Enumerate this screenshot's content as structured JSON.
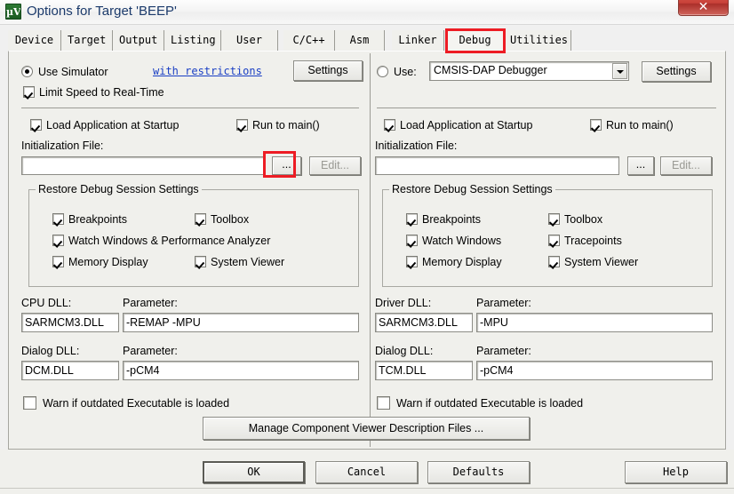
{
  "window": {
    "title": "Options for Target 'BEEP'",
    "icon": "keil-uvision-icon",
    "icon_text": "µVs",
    "close_label": "✕",
    "accent_red": "#ed1c24",
    "link_blue": "#1a3fc4",
    "title_blue": "#1b3a6b"
  },
  "tabs": [
    {
      "label": "Device",
      "selected": false
    },
    {
      "label": "Target",
      "selected": false
    },
    {
      "label": "Output",
      "selected": false
    },
    {
      "label": "Listing",
      "selected": false
    },
    {
      "label": "User",
      "selected": false
    },
    {
      "label": "C/C++",
      "selected": false
    },
    {
      "label": "Asm",
      "selected": false
    },
    {
      "label": "Linker",
      "selected": false
    },
    {
      "label": "Debug",
      "selected": true
    },
    {
      "label": "Utilities",
      "selected": false
    }
  ],
  "left_panel": {
    "use_simulator_label": "Use Simulator",
    "use_simulator_checked": true,
    "with_restrictions_link": "with restrictions",
    "settings_button": "Settings",
    "limit_speed_label": "Limit Speed to Real-Time",
    "limit_speed_checked": true,
    "load_app_label": "Load Application at Startup",
    "load_app_checked": true,
    "run_to_main_label": "Run to main()",
    "run_to_main_checked": true,
    "init_file_label": "Initialization File:",
    "init_file_value": "",
    "init_file_placeholder": "",
    "browse_button": "...",
    "edit_button": "Edit...",
    "edit_button_disabled": true,
    "restore_group_title": "Restore Debug Session Settings",
    "restore_items": [
      {
        "label": "Breakpoints",
        "checked": true
      },
      {
        "label": "Toolbox",
        "checked": true
      },
      {
        "label": "Watch Windows & Performance Analyzer",
        "checked": true
      },
      {
        "label": "Memory Display",
        "checked": true
      },
      {
        "label": "System Viewer",
        "checked": true
      }
    ],
    "cpu_dll_label": "CPU DLL:",
    "cpu_dll_value": "SARMCM3.DLL",
    "cpu_param_label": "Parameter:",
    "cpu_param_value": "-REMAP -MPU",
    "dialog_dll_label": "Dialog DLL:",
    "dialog_dll_value": "DCM.DLL",
    "dialog_param_label": "Parameter:",
    "dialog_param_value": "-pCM4",
    "warn_outdated_label": "Warn if outdated Executable is loaded",
    "warn_outdated_checked": false
  },
  "right_panel": {
    "use_label": "Use:",
    "use_checked": false,
    "debugger_selected": "CMSIS-DAP Debugger",
    "settings_button": "Settings",
    "load_app_label": "Load Application at Startup",
    "load_app_checked": true,
    "run_to_main_label": "Run to main()",
    "run_to_main_checked": true,
    "init_file_label": "Initialization File:",
    "init_file_value": "",
    "browse_button": "...",
    "edit_button": "Edit...",
    "edit_button_disabled": true,
    "restore_group_title": "Restore Debug Session Settings",
    "restore_items": [
      {
        "label": "Breakpoints",
        "checked": true
      },
      {
        "label": "Toolbox",
        "checked": true
      },
      {
        "label": "Watch Windows",
        "checked": true
      },
      {
        "label": "Tracepoints",
        "checked": true
      },
      {
        "label": "Memory Display",
        "checked": true
      },
      {
        "label": "System Viewer",
        "checked": true
      }
    ],
    "driver_dll_label": "Driver DLL:",
    "driver_dll_value": "SARMCM3.DLL",
    "driver_param_label": "Parameter:",
    "driver_param_value": "-MPU",
    "dialog_dll_label": "Dialog DLL:",
    "dialog_dll_value": "TCM.DLL",
    "dialog_param_label": "Parameter:",
    "dialog_param_value": "-pCM4",
    "warn_outdated_label": "Warn if outdated Executable is loaded",
    "warn_outdated_checked": false
  },
  "manage_button": "Manage Component Viewer Description Files ...",
  "footer": {
    "ok": "OK",
    "cancel": "Cancel",
    "defaults": "Defaults",
    "help": "Help"
  }
}
